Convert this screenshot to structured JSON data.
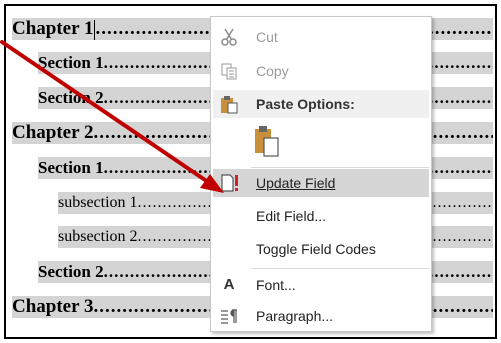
{
  "toc": [
    {
      "level": "h1",
      "title": "Chapter 1",
      "dots": "............................................................................................"
    },
    {
      "level": "h2",
      "title": "Section 1",
      "dots": "............................................................................................................"
    },
    {
      "level": "h2",
      "title": "Section 2",
      "dots": "............................................................................................................"
    },
    {
      "level": "h1",
      "title": "Chapter 2",
      "dots": "............................................................................................"
    },
    {
      "level": "h2",
      "title": "Section 1",
      "dots": "............................................................................................................"
    },
    {
      "level": "h3",
      "title": "subsection 1",
      "dots": "................................................................................................................................"
    },
    {
      "level": "h3",
      "title": "subsection 2",
      "dots": "................................................................................................................................"
    },
    {
      "level": "h2",
      "title": "Section 2",
      "dots": "............................................................................................................"
    },
    {
      "level": "h1",
      "title": "Chapter 3",
      "dots": "............................................................................................"
    }
  ],
  "menu": {
    "cut": "Cut",
    "copy": "Copy",
    "paste_options": "Paste Options:",
    "update_field": "Update Field",
    "edit_field": "Edit Field...",
    "toggle_field_codes": "Toggle Field Codes",
    "font": "Font...",
    "paragraph": "Paragraph..."
  },
  "colors": {
    "arrow": "#c00000",
    "field_shading": "#d4d4d4",
    "menu_highlight": "#d6d6d6"
  },
  "icons": {
    "cut": "scissors-icon",
    "copy": "copy-icon",
    "paste": "clipboard-icon",
    "update_field": "update-field-icon",
    "font": "font-icon",
    "paragraph": "paragraph-icon"
  }
}
